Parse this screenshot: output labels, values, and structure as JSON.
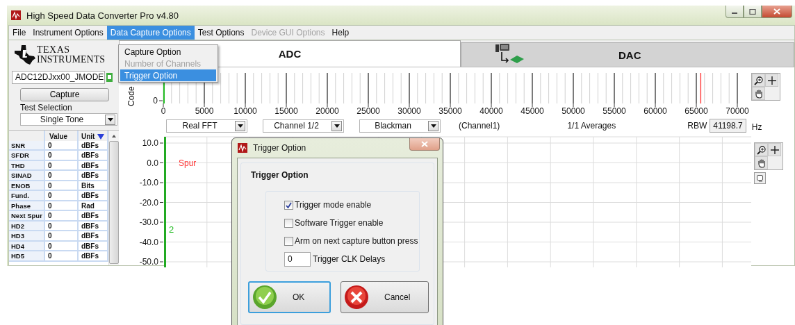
{
  "window": {
    "title": "High Speed Data Converter Pro v4.80"
  },
  "menu_bar": [
    {
      "label": "File",
      "selected": false,
      "disabled": false
    },
    {
      "label": "Instrument Options",
      "selected": false,
      "disabled": false
    },
    {
      "label": "Data Capture Options",
      "selected": true,
      "disabled": false
    },
    {
      "label": "Test Options",
      "selected": false,
      "disabled": false
    },
    {
      "label": "Device GUI Options",
      "selected": false,
      "disabled": true
    },
    {
      "label": "Help",
      "selected": false,
      "disabled": false
    }
  ],
  "menu_dropdown": [
    {
      "label": "Capture Option",
      "selected": false,
      "disabled": false
    },
    {
      "label": "Number of Channels",
      "selected": false,
      "disabled": true
    },
    {
      "label": "Trigger Option",
      "selected": true,
      "disabled": false
    }
  ],
  "logo": {
    "line1": "TEXAS",
    "line2": "INSTRUMENTS"
  },
  "left_panel": {
    "device": "ADC12DJxx00_JMODE",
    "capture_button": "Capture",
    "test_selection_label": "Test Selection",
    "test_selection": "Single Tone"
  },
  "results_table": {
    "columns": [
      "Value",
      "Unit"
    ],
    "rows": [
      {
        "name": "SNR",
        "value": "0",
        "unit": "dBFs"
      },
      {
        "name": "SFDR",
        "value": "0",
        "unit": "dBFs"
      },
      {
        "name": "THD",
        "value": "0",
        "unit": "dBFs"
      },
      {
        "name": "SINAD",
        "value": "0",
        "unit": "dBFs"
      },
      {
        "name": "ENOB",
        "value": "0",
        "unit": "Bits"
      },
      {
        "name": "Fund.",
        "value": "0",
        "unit": "dBFs"
      },
      {
        "name": "Phase",
        "value": "0",
        "unit": "Rad"
      },
      {
        "name": "Next Spur",
        "value": "0",
        "unit": "dBFs"
      },
      {
        "name": "HD2",
        "value": "0",
        "unit": "dBFs"
      },
      {
        "name": "HD3",
        "value": "0",
        "unit": "dBFs"
      },
      {
        "name": "HD4",
        "value": "0",
        "unit": "dBFs"
      },
      {
        "name": "HD5",
        "value": "0",
        "unit": "dBFs"
      }
    ]
  },
  "tabs": [
    {
      "label": "ADC",
      "selected": true
    },
    {
      "label": "DAC",
      "selected": false
    }
  ],
  "code_plot": {
    "ylabel": "Code",
    "y_ticks": [
      "0"
    ],
    "x_ticks": [
      "0",
      "5000",
      "10000",
      "15000",
      "20000",
      "25000",
      "30000",
      "35000",
      "40000",
      "45000",
      "50000",
      "55000",
      "60000",
      "65000",
      "70000"
    ]
  },
  "controls": {
    "fft_type": "Real FFT",
    "channel": "Channel 1/2",
    "window_function": "Blackman",
    "channel_label": "(Channel1)",
    "averages": "1/1 Averages",
    "rbw_label": "RBW",
    "rbw_value": "41198.7",
    "rbw_unit": "Hz"
  },
  "spectrum_plot": {
    "y_ticks": [
      "10.0",
      "0.0",
      "-10.0",
      "-20.0",
      "-30.0",
      "-40.0",
      "-50.0"
    ],
    "annotations": [
      {
        "label": "Spur",
        "color": "#ff3333"
      },
      {
        "label": "2",
        "color": "#22bb22"
      }
    ]
  },
  "dialog": {
    "title": "Trigger Option",
    "heading": "Trigger Option",
    "options": [
      {
        "kind": "checkbox",
        "label": "Trigger mode enable",
        "checked": true
      },
      {
        "kind": "checkbox",
        "label": "Software Trigger enable",
        "checked": false
      },
      {
        "kind": "checkbox",
        "label": "Arm on next capture button press",
        "checked": false
      },
      {
        "kind": "number",
        "label": "Trigger CLK Delays",
        "value": "0"
      }
    ],
    "buttons": [
      {
        "kind": "ok",
        "label": "OK",
        "focused": true
      },
      {
        "kind": "cancel",
        "label": "Cancel",
        "focused": false
      }
    ]
  }
}
